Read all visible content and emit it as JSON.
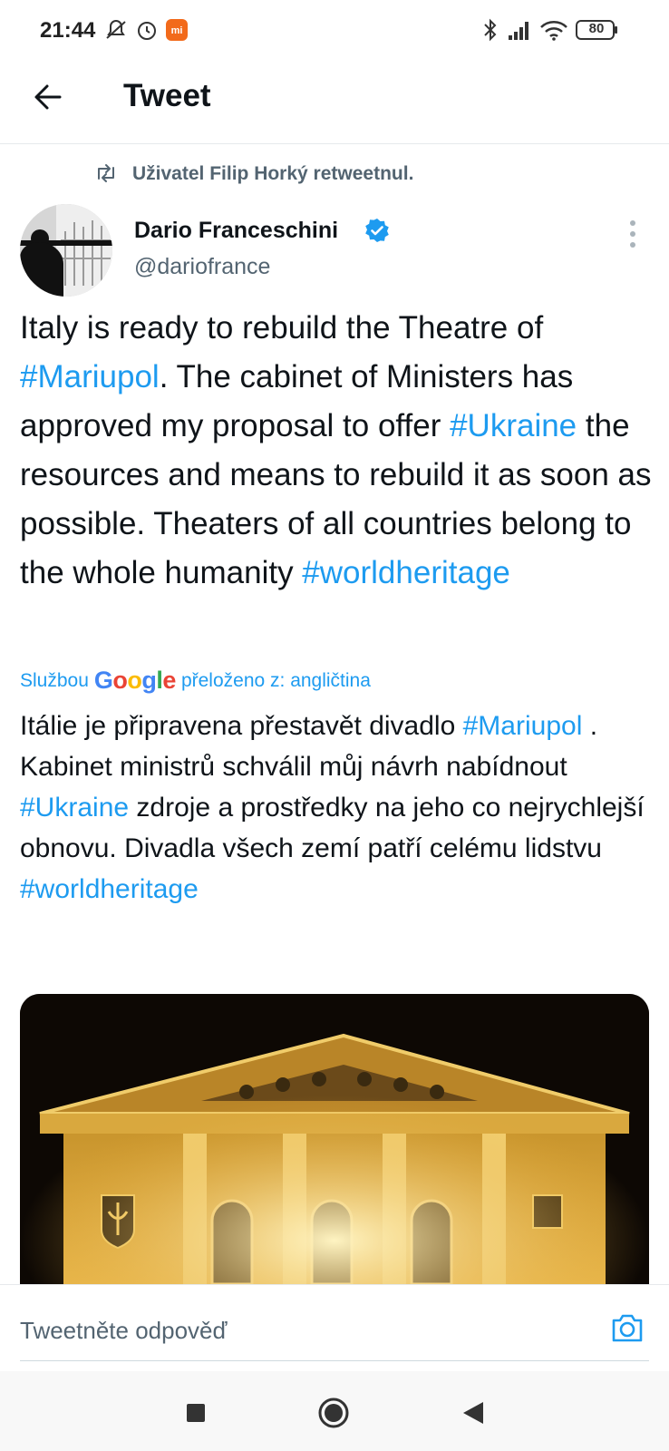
{
  "status_bar": {
    "time": "21:44",
    "battery": "80",
    "icons": [
      "mute-icon",
      "alarm-icon",
      "mi-app-icon",
      "bluetooth-icon",
      "signal-icon",
      "wifi-icon",
      "battery-icon"
    ]
  },
  "header": {
    "title": "Tweet",
    "back_icon": "arrow-left-icon"
  },
  "retweet": {
    "text": "Uživatel Filip Horký retweetnul."
  },
  "author": {
    "name": "Dario Franceschini",
    "handle": "@dariofrance",
    "verified": true
  },
  "tweet": {
    "part1": "Italy is ready to rebuild the Theatre of ",
    "tag1": "#Mariupol",
    "part2": ". The cabinet of Ministers has approved my proposal to offer ",
    "tag2": "#Ukraine",
    "part3": " the resources and means to rebuild it as soon as possible. Theaters of all countries belong to the whole humanity ",
    "tag3": "#worldheritage"
  },
  "translation": {
    "prefix": "Službou",
    "brand": "Google",
    "suffix": "přeloženo z: angličtina",
    "part1": "Itálie je připravena přestavět divadlo ",
    "tag1": "#Mariupol",
    "part2": " . Kabinet ministrů schválil můj návrh nabídnout ",
    "tag2": "#Ukraine",
    "part3": " zdroje a prostředky na jeho co nejrychlejší obnovu. Divadla všech zemí patří celému lidstvu ",
    "tag3": "#worldheritage"
  },
  "reply": {
    "placeholder": "Tweetněte odpověď"
  },
  "colors": {
    "link": "#1d9bf0",
    "text": "#0f1419",
    "secondary": "#536471"
  }
}
